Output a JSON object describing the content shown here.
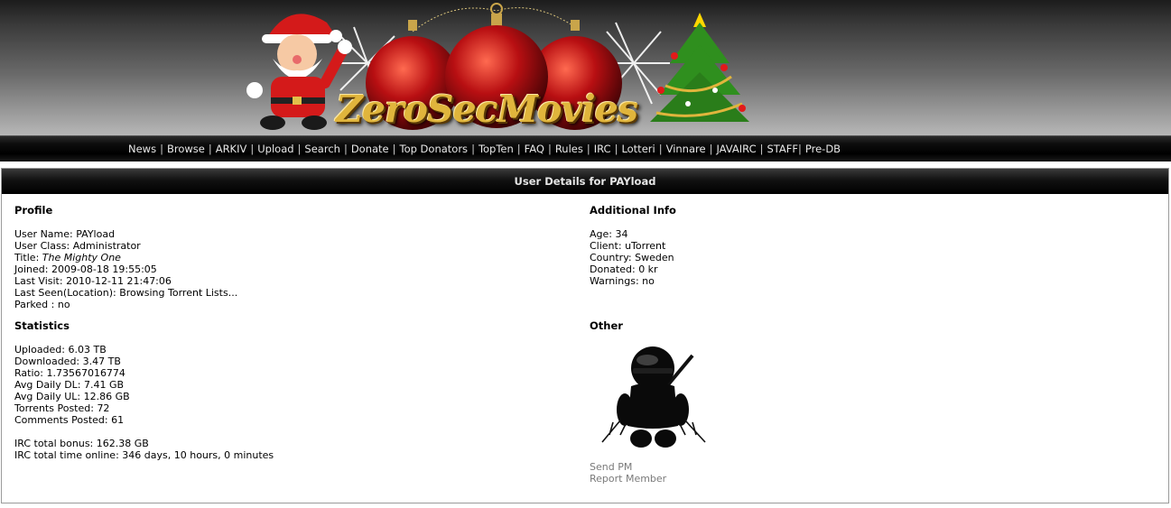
{
  "header": {
    "logo_text": "ZeroSecMovies",
    "colors": {
      "logo_gold": "#e0b53c",
      "ornament_red": "#b80f12",
      "tree_green": "#2f8f1e"
    }
  },
  "nav": {
    "items": [
      "News",
      "Browse",
      "ARKIV",
      "Upload",
      "Search",
      "Donate",
      "Top Donators",
      "TopTen",
      "FAQ",
      "Rules",
      "IRC",
      "Lotteri",
      "Vinnare",
      "JAVAIRC",
      "STAFF",
      "Pre-DB"
    ]
  },
  "panel": {
    "title": "User Details for PAYload",
    "profile": {
      "heading": "Profile",
      "user_name_label": "User Name: ",
      "user_name": "PAYload",
      "user_class_label": "User Class: ",
      "user_class": "Administrator",
      "title_label": "Title: ",
      "title": "The Mighty One",
      "joined_label": "Joined: ",
      "joined": "2009-08-18 19:55:05",
      "last_visit_label": "Last Visit: ",
      "last_visit": "2010-12-11 21:47:06",
      "last_seen_label": "Last Seen(Location): ",
      "last_seen": "Browsing Torrent Lists...",
      "parked_label": "Parked : ",
      "parked": "no"
    },
    "statistics": {
      "heading": "Statistics",
      "uploaded_label": "Uploaded: ",
      "uploaded": "6.03 TB",
      "downloaded_label": "Downloaded: ",
      "downloaded": "3.47 TB",
      "ratio_label": "Ratio: ",
      "ratio": "1.73567016774",
      "avg_dl_label": "Avg Daily DL: ",
      "avg_dl": "7.41 GB",
      "avg_ul_label": "Avg Daily UL: ",
      "avg_ul": "12.86 GB",
      "torrents_label": "Torrents Posted: ",
      "torrents": "72",
      "comments_label": "Comments Posted: ",
      "comments": "61",
      "irc_bonus_label": "IRC total bonus: ",
      "irc_bonus": "162.38 GB",
      "irc_time_label": "IRC total time online: ",
      "irc_time": "346 days, 10 hours, 0 minutes"
    },
    "additional": {
      "heading": "Additional Info",
      "age_label": "Age: ",
      "age": "34",
      "client_label": "Client: ",
      "client": "uTorrent",
      "country_label": "Country: ",
      "country": "Sweden",
      "donated_label": "Donated: ",
      "donated": "0 kr",
      "warnings_label": "Warnings: ",
      "warnings": "no"
    },
    "other": {
      "heading": "Other",
      "avatar_icon": "ninja-avatar-icon",
      "send_pm": "Send PM",
      "report_member": "Report Member"
    }
  }
}
